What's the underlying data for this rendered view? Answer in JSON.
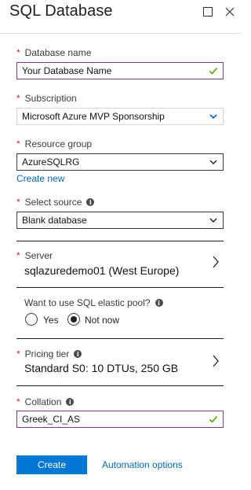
{
  "header": {
    "title": "SQL Database"
  },
  "form": {
    "required_mark": "*",
    "database_name": {
      "label": "Database name",
      "value": "Your Database Name"
    },
    "subscription": {
      "label": "Subscription",
      "value": "Microsoft Azure  MVP Sponsorship"
    },
    "resource_group": {
      "label": "Resource group",
      "value": "AzureSQLRG",
      "create_new": "Create new"
    },
    "select_source": {
      "label": "Select source",
      "value": "Blank database"
    },
    "server": {
      "label": "Server",
      "value": "sqlazuredemo01 (West Europe)"
    },
    "elastic_pool": {
      "label": "Want to use SQL elastic pool?",
      "option_yes": "Yes",
      "option_no": "Not now",
      "selected": "Not now"
    },
    "pricing_tier": {
      "label": "Pricing tier",
      "value": "Standard S0: 10 DTUs, 250 GB"
    },
    "collation": {
      "label": "Collation",
      "value": "Greek_CI_AS"
    }
  },
  "footer": {
    "create_label": "Create",
    "automation_label": "Automation options"
  },
  "colors": {
    "accent": "#0078d4",
    "valid_border": "#7a3b8d",
    "check": "#57a300",
    "required": "#c4262c",
    "link": "#0067c0"
  }
}
